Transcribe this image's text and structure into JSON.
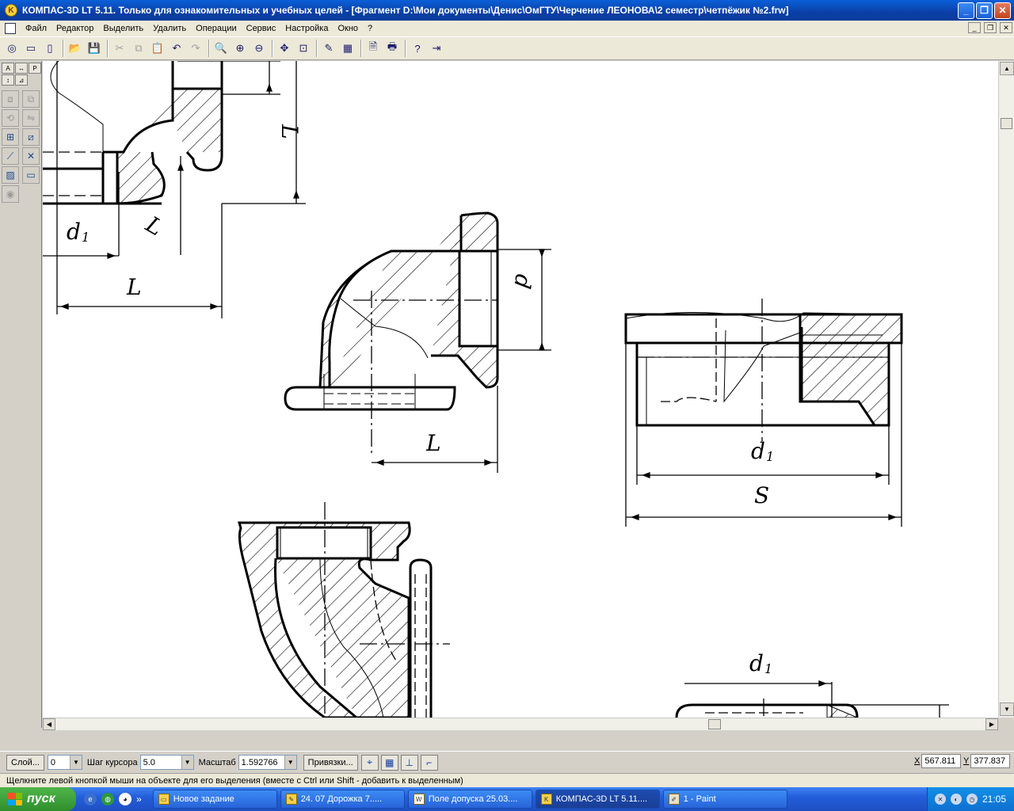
{
  "window": {
    "title": "КОМПАС-3D LT 5.11. Только для ознакомительных и учебных целей - [Фрагмент D:\\Мои документы\\Денис\\ОмГТУ\\Черчение ЛЕОНОВА\\2 семестр\\четпёжик №2.frw]",
    "minimize": "_",
    "restore": "❐",
    "close": "✕"
  },
  "menu": {
    "items": [
      "Файл",
      "Редактор",
      "Выделить",
      "Удалить",
      "Операции",
      "Сервис",
      "Настройка",
      "Окно",
      "?"
    ]
  },
  "drawing": {
    "labels": {
      "top_d1": "d",
      "top_d1_sub": "1",
      "top_L_horiz": "L",
      "top_L_vert": "L",
      "top_L_small": "L",
      "mid_d": "d",
      "mid_L": "L",
      "right_d1": "d",
      "right_d1_sub": "1",
      "right_S": "S",
      "bottom_d1": "d",
      "bottom_d1_sub": "1"
    }
  },
  "properties": {
    "layer_button": "Слой...",
    "layer_value": "0",
    "step_label": "Шаг курсора",
    "step_value": "5.0",
    "scale_label": "Масштаб",
    "scale_value": "1.592766",
    "snaps_button": "Привязки...",
    "x_label": "X",
    "x_value": "567.811",
    "y_label": "Y",
    "y_value": "377.837"
  },
  "status": {
    "text": "Щелкните левой кнопкой мыши на объекте для его выделения (вместе с Ctrl или Shift - добавить к выделенным)"
  },
  "taskbar": {
    "start": "пуск",
    "tasks": [
      {
        "label": "Новое задание"
      },
      {
        "label": "24. 07 Дорожка 7....."
      },
      {
        "label": "Поле допуска 25.03...."
      },
      {
        "label": "КОМПАС-3D LT 5.11...."
      },
      {
        "label": "1 - Paint"
      }
    ],
    "clock": "21:05",
    "more": "»"
  }
}
